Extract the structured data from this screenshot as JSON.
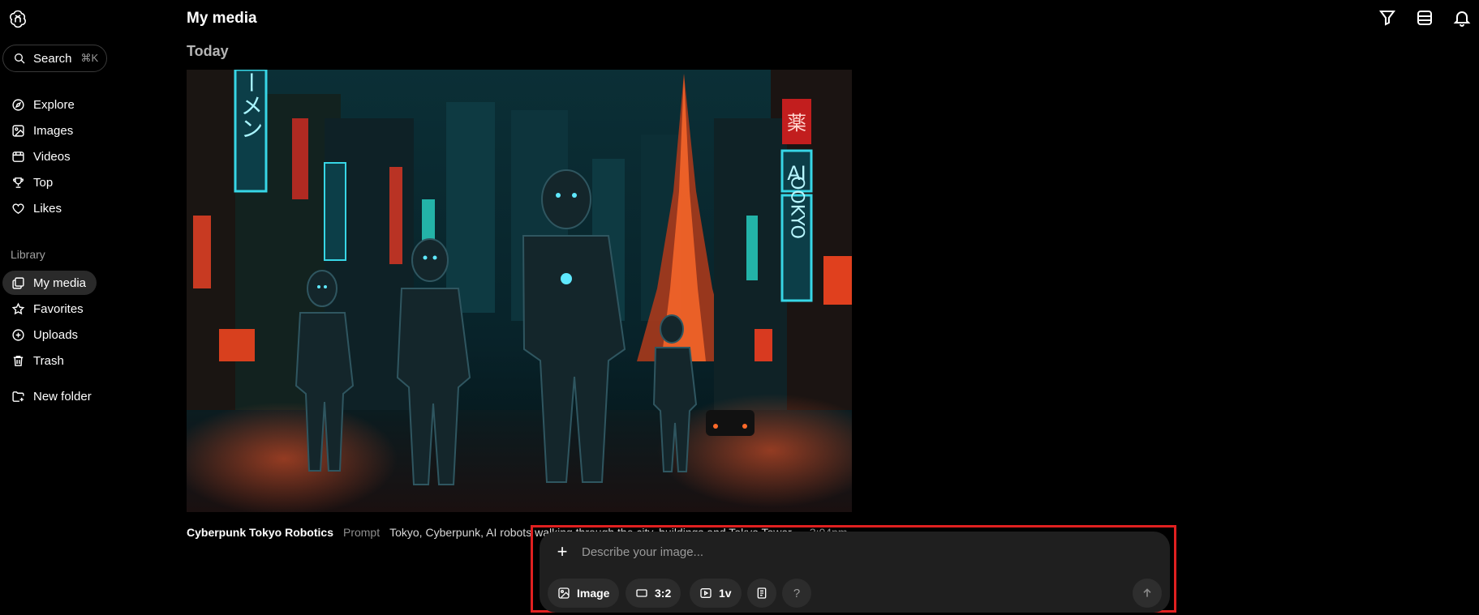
{
  "header": {
    "title": "My media"
  },
  "search": {
    "label": "Search",
    "shortcut": "⌘K"
  },
  "nav": {
    "explore": "Explore",
    "images": "Images",
    "videos": "Videos",
    "top": "Top",
    "likes": "Likes"
  },
  "library": {
    "label": "Library",
    "my_media": "My media",
    "favorites": "Favorites",
    "uploads": "Uploads",
    "trash": "Trash",
    "new_folder": "New folder"
  },
  "media": {
    "group_label": "Today",
    "item": {
      "title": "Cyberpunk Tokyo Robotics",
      "prompt_label": "Prompt",
      "prompt_text": "Tokyo, Cyberpunk, AI robots walking through the city, buildings and Tokyo Tower",
      "time": "3:04pm",
      "sign_left": "ラーメン",
      "sign_right_top": "薬",
      "sign_right_ai": "AI",
      "sign_right_tokyo": "OOKYO"
    }
  },
  "composer": {
    "placeholder": "Describe your image...",
    "type_label": "Image",
    "ratio_label": "3:2",
    "variations_label": "1v",
    "help_label": "?"
  },
  "colors": {
    "background": "#000000",
    "sidebar_active": "#2a2a2a",
    "composer_bg": "#1f1f1f",
    "highlight_border": "#e02020"
  }
}
